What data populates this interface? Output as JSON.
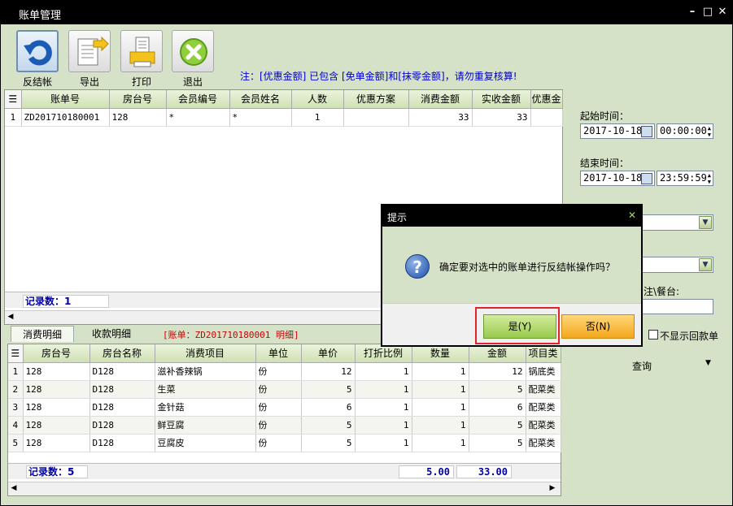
{
  "window": {
    "title": "账单管理"
  },
  "toolbar": {
    "buttons": [
      {
        "label": "反结帐",
        "icon": "undo-icon"
      },
      {
        "label": "导出",
        "icon": "export-icon"
      },
      {
        "label": "打印",
        "icon": "print-icon"
      },
      {
        "label": "退出",
        "icon": "exit-icon"
      }
    ],
    "note": "注：[优惠金额] 已包含 [免单金额]和[抹零金额]，请勿重复核算!"
  },
  "bill_grid": {
    "columns": [
      "账单号",
      "房台号",
      "会员编号",
      "会员姓名",
      "人数",
      "优惠方案",
      "消费金额",
      "实收金额",
      "优惠金"
    ],
    "rows": [
      {
        "no": "1",
        "bill": "ZD201710180001",
        "room": "128",
        "member_no": "*",
        "member_name": "*",
        "people": "1",
        "plan": "",
        "amount": "33",
        "received": "33"
      }
    ],
    "record_count": "记录数：1"
  },
  "tabs": {
    "items": [
      "消费明细",
      "收款明细"
    ],
    "info": "[账单：ZD201710180001 明细]"
  },
  "detail_grid": {
    "columns": [
      "房台号",
      "房台名称",
      "消费项目",
      "单位",
      "单价",
      "打折比例",
      "数量",
      "金额",
      "项目类"
    ],
    "rows": [
      {
        "no": "1",
        "room": "128",
        "room_name": "D128",
        "item": "滋补香辣锅",
        "unit": "份",
        "price": "12",
        "discount": "1",
        "qty": "1",
        "amount": "12",
        "category": "锅底类"
      },
      {
        "no": "2",
        "room": "128",
        "room_name": "D128",
        "item": "生菜",
        "unit": "份",
        "price": "5",
        "discount": "1",
        "qty": "1",
        "amount": "5",
        "category": "配菜类"
      },
      {
        "no": "3",
        "room": "128",
        "room_name": "D128",
        "item": "金针菇",
        "unit": "份",
        "price": "6",
        "discount": "1",
        "qty": "1",
        "amount": "6",
        "category": "配菜类"
      },
      {
        "no": "4",
        "room": "128",
        "room_name": "D128",
        "item": "鲜豆腐",
        "unit": "份",
        "price": "5",
        "discount": "1",
        "qty": "1",
        "amount": "5",
        "category": "配菜类"
      },
      {
        "no": "5",
        "room": "128",
        "room_name": "D128",
        "item": "豆腐皮",
        "unit": "份",
        "price": "5",
        "discount": "1",
        "qty": "1",
        "amount": "5",
        "category": "配菜类"
      }
    ],
    "record_count": "记录数：5",
    "sum_qty": "5.00",
    "sum_amount": "33.00"
  },
  "filters": {
    "start_label": "起始时间：",
    "start_date": "2017-10-18",
    "start_time": "00:00:00",
    "end_label": "结束时间：",
    "end_date": "2017-10-18",
    "end_time": "23:59:59",
    "remark_label_fragment": "注\\餐台:",
    "hide_refund_label": "不显示回款单",
    "query_label": "查询"
  },
  "dialog": {
    "title": "提示",
    "message": "确定要对选中的账单进行反结帐操作吗？",
    "yes_label": "是(Y)",
    "no_label": "否(N)"
  }
}
